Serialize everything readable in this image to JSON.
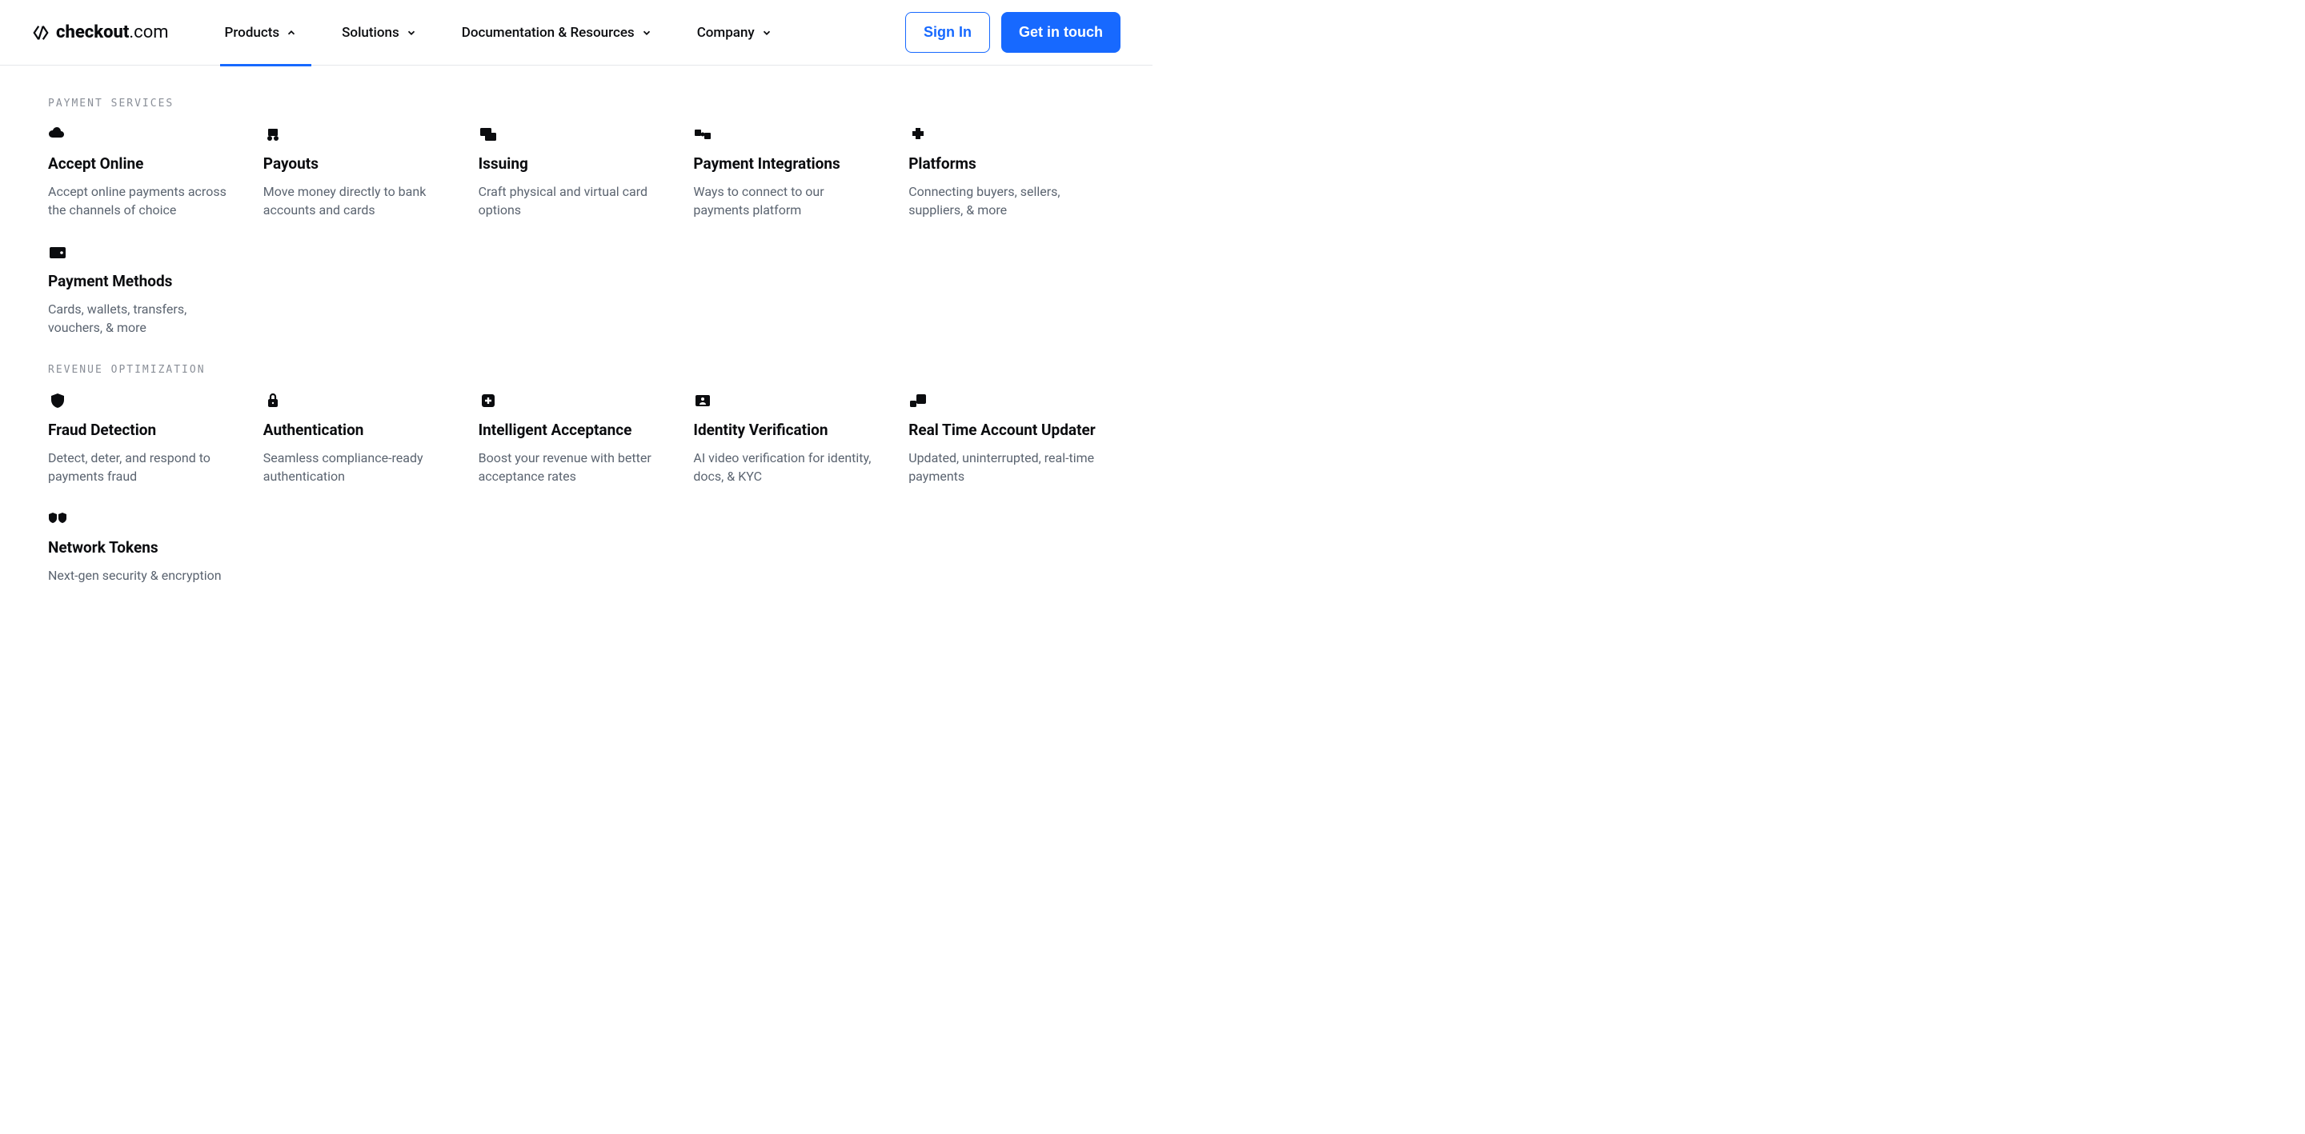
{
  "brand": {
    "bold": "checkout",
    "regular": ".com"
  },
  "nav": {
    "items": [
      {
        "label": "Products"
      },
      {
        "label": "Solutions"
      },
      {
        "label": "Documentation & Resources"
      },
      {
        "label": "Company"
      }
    ]
  },
  "actions": {
    "signin": "Sign In",
    "contact": "Get in touch"
  },
  "sections": [
    {
      "label": "PAYMENT SERVICES",
      "items": [
        {
          "icon": "cloud-icon",
          "title": "Accept Online",
          "desc": "Accept online payments across the channels of choice"
        },
        {
          "icon": "payouts-icon",
          "title": "Payouts",
          "desc": "Move money directly to bank accounts and cards"
        },
        {
          "icon": "issuing-icon",
          "title": "Issuing",
          "desc": "Craft physical and virtual card options"
        },
        {
          "icon": "integrations-icon",
          "title": "Payment Integrations",
          "desc": "Ways to connect to our payments platform"
        },
        {
          "icon": "platforms-icon",
          "title": "Platforms",
          "desc": "Connecting buyers, sellers, suppliers, & more"
        },
        {
          "icon": "wallet-icon",
          "title": "Payment Methods",
          "desc": "Cards, wallets, transfers, vouchers, & more"
        }
      ]
    },
    {
      "label": "REVENUE OPTIMIZATION",
      "items": [
        {
          "icon": "shield-icon",
          "title": "Fraud Detection",
          "desc": "Detect, deter, and respond to payments fraud"
        },
        {
          "icon": "lock-icon",
          "title": "Authentication",
          "desc": "Seamless compliance-ready authentication"
        },
        {
          "icon": "plus-box-icon",
          "title": "Intelligent Acceptance",
          "desc": "Boost your revenue with better acceptance rates"
        },
        {
          "icon": "id-icon",
          "title": "Identity Verification",
          "desc": "AI video verification for identity, docs, & KYC"
        },
        {
          "icon": "updater-icon",
          "title": "Real Time Account Updater",
          "desc": "Updated, uninterrupted, real-time payments"
        },
        {
          "icon": "tokens-icon",
          "title": "Network Tokens",
          "desc": "Next-gen security & encryption"
        }
      ]
    }
  ]
}
